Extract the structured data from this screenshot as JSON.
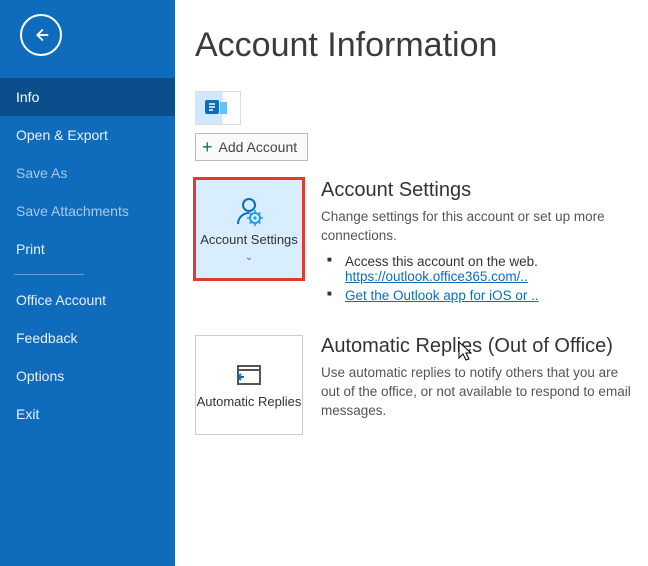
{
  "sidebar": {
    "items": [
      {
        "label": "Info",
        "active": true
      },
      {
        "label": "Open & Export"
      },
      {
        "label": "Save As",
        "dim": true
      },
      {
        "label": "Save Attachments",
        "dim": true
      },
      {
        "label": "Print"
      }
    ],
    "lower_items": [
      {
        "label": "Office Account"
      },
      {
        "label": "Feedback"
      },
      {
        "label": "Options"
      },
      {
        "label": "Exit"
      }
    ]
  },
  "main": {
    "title": "Account Information",
    "add_account_label": "Add Account",
    "account_settings": {
      "tile_label": "Account Settings",
      "heading": "Account Settings",
      "desc": "Change settings for this account or set up more connections.",
      "bullet1_prefix": "Access this account on the web.",
      "bullet1_link": "https://outlook.office365.com/..",
      "bullet2_link": "Get the Outlook app for iOS or .."
    },
    "auto_replies": {
      "tile_label": "Automatic Replies",
      "heading": "Automatic Replies (Out of Office)",
      "desc": "Use automatic replies to notify others that you are out of the office, or not available to respond to email messages."
    }
  }
}
